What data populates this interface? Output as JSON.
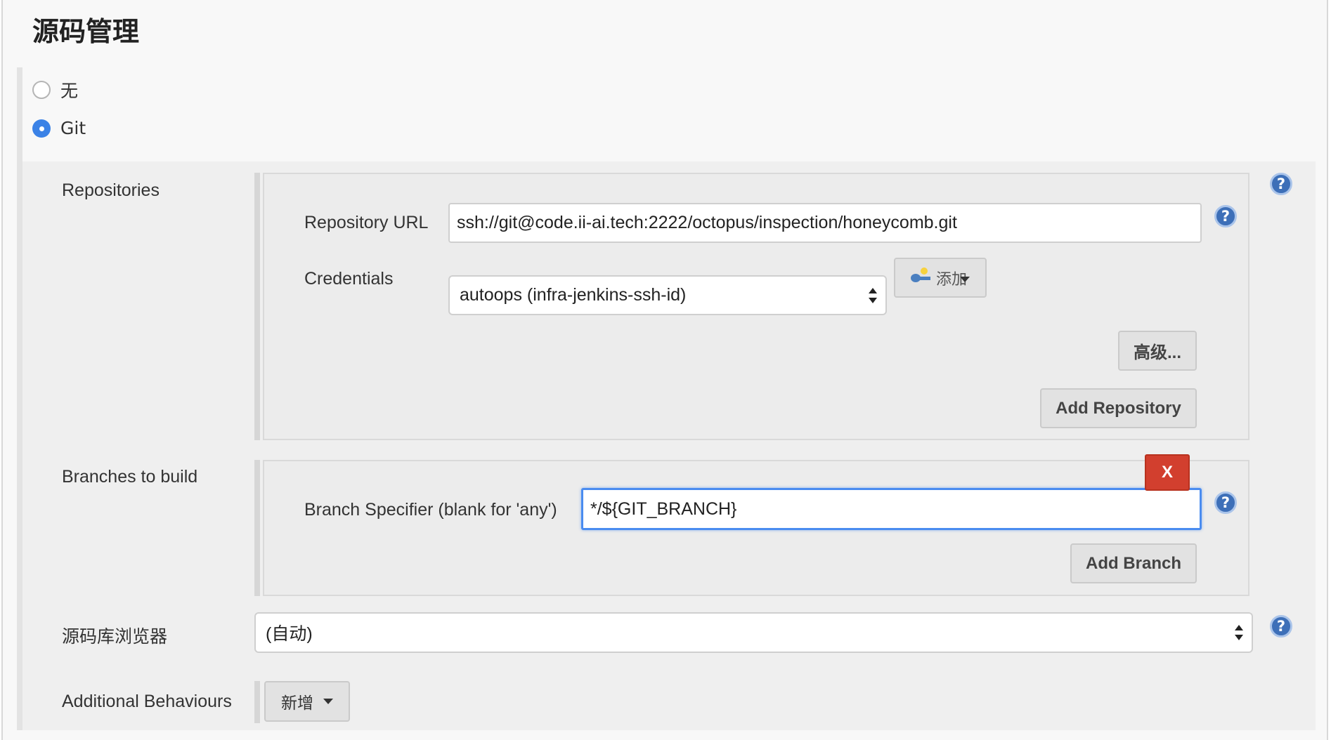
{
  "section_title": "源码管理",
  "scm_options": [
    {
      "label": "无",
      "checked": false
    },
    {
      "label": "Git",
      "checked": true
    }
  ],
  "repositories": {
    "label": "Repositories",
    "url_label": "Repository URL",
    "url_value": "ssh://git@code.ii-ai.tech:2222/octopus/inspection/honeycomb.git",
    "credentials_label": "Credentials",
    "credentials_value": "autoops (infra-jenkins-ssh-id)",
    "add_button": "添加",
    "advanced_button": "高级...",
    "add_repository_button": "Add Repository"
  },
  "branches": {
    "label": "Branches to build",
    "specifier_label": "Branch Specifier (blank for 'any')",
    "specifier_value": "*/${GIT_BRANCH}",
    "delete_button": "X",
    "add_branch_button": "Add Branch"
  },
  "browser": {
    "label": "源码库浏览器",
    "value": "(自动)"
  },
  "behaviours": {
    "label": "Additional Behaviours",
    "add_button": "新增"
  },
  "help_glyph": "?",
  "colors": {
    "radio_checked": "#3b82e6",
    "help_icon": "#3d6fb8",
    "delete_button": "#d23f2e",
    "focus_border": "#4a8cf0"
  }
}
